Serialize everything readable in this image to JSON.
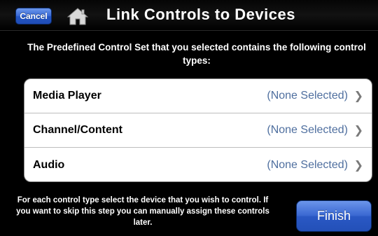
{
  "navbar": {
    "cancel_label": "Cancel",
    "home_icon": "home-icon",
    "title": "Link Controls to Devices"
  },
  "intro_text": "The Predefined Control Set that you selected contains the following control types:",
  "controls": [
    {
      "label": "Media Player",
      "value": "(None Selected)",
      "icon": "chevron-right-icon"
    },
    {
      "label": "Channel/Content",
      "value": "(None Selected)",
      "icon": "chevron-right-icon"
    },
    {
      "label": "Audio",
      "value": "(None Selected)",
      "icon": "chevron-right-icon"
    }
  ],
  "footer_text": "For each control type select the device that you wish to control. If you want to skip this step you can manually assign these controls later.",
  "finish_label": "Finish",
  "colors": {
    "accent_blue": "#3a68d2",
    "value_blue": "#4f6f9f",
    "background": "#000000"
  }
}
